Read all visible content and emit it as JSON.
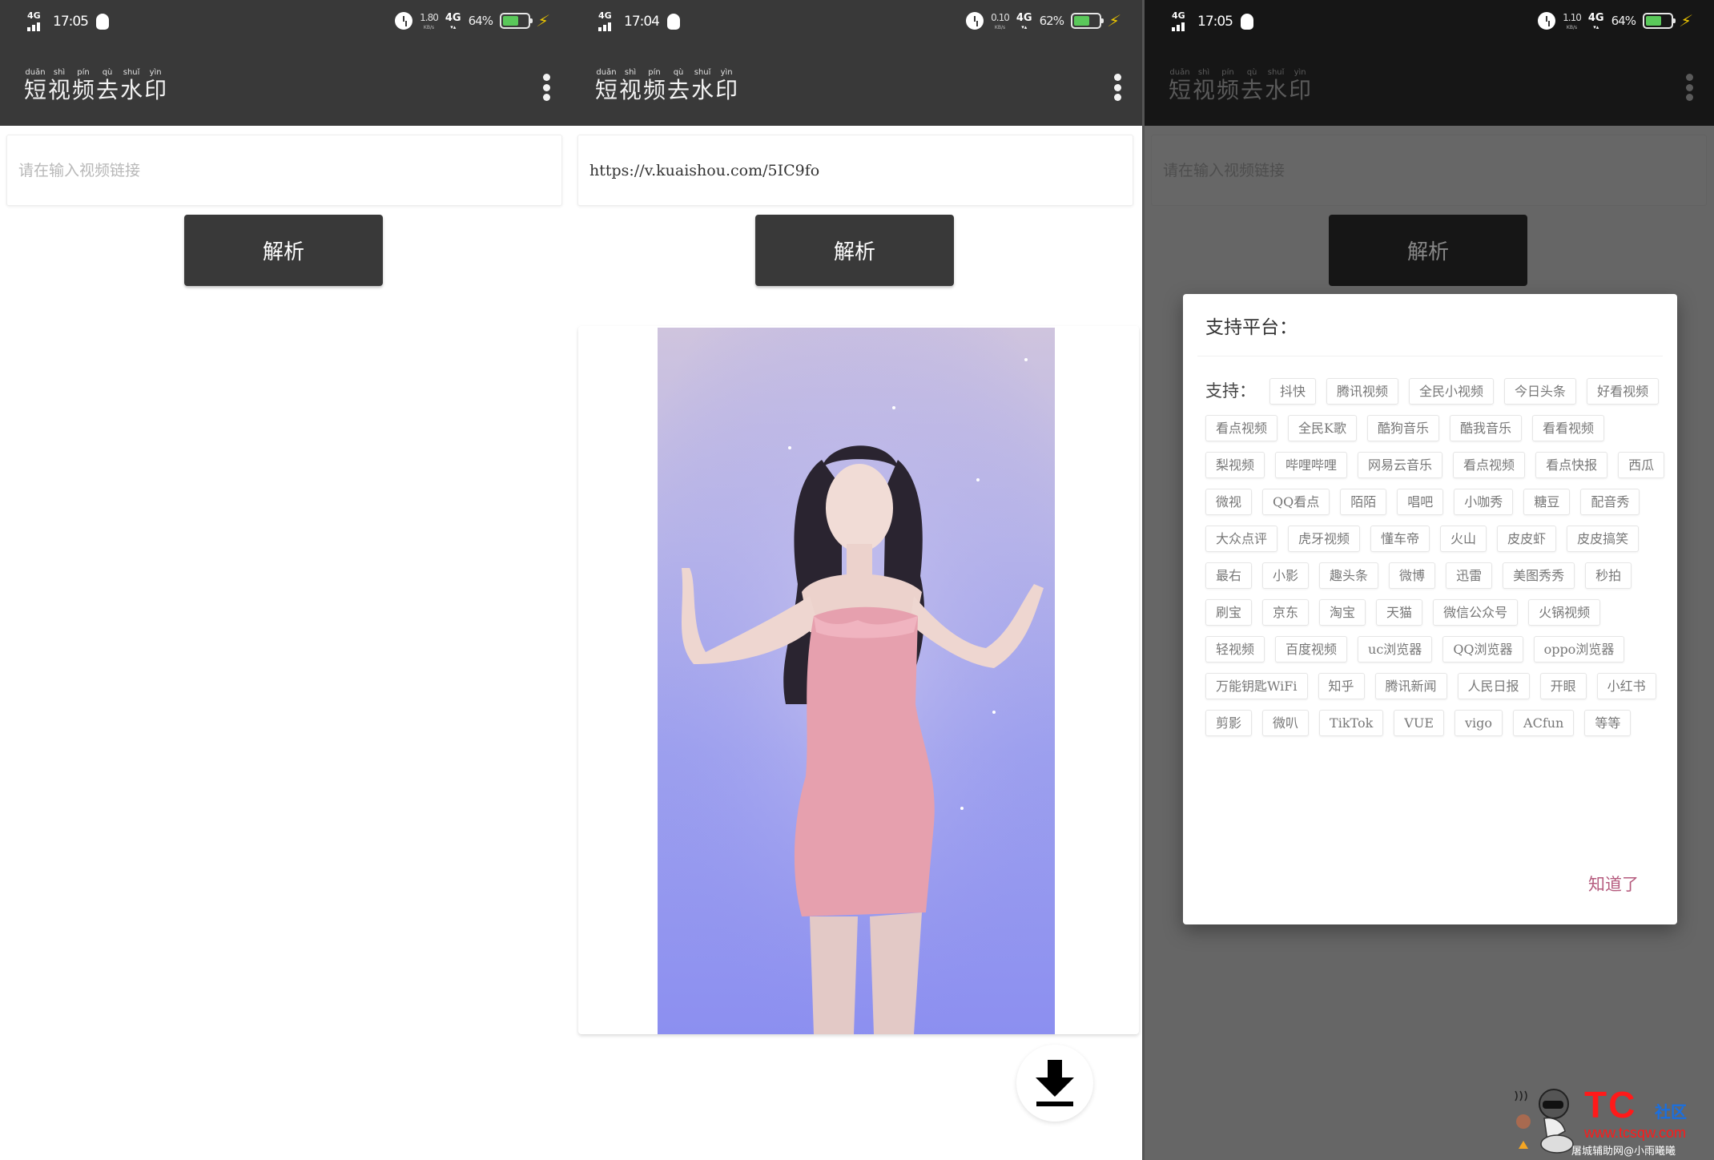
{
  "panels": [
    {
      "status_bar": {
        "network": "4G",
        "time": "17:05",
        "speed_value": "1.80",
        "speed_unit": "KB/s",
        "data_network": "4G",
        "battery_percent": "64%",
        "battery_level": 0.64
      },
      "app_bar": {
        "title_chars": [
          "短",
          "视",
          "频",
          "去",
          "水",
          "印"
        ],
        "title_pinyin": [
          "duǎn",
          "shì",
          "pín",
          "qù",
          "shuǐ",
          "yìn"
        ],
        "menu_icon": "more-vert-icon"
      },
      "input": {
        "value": "",
        "placeholder": "请在输入视频链接"
      },
      "parse_button": {
        "label": "解析"
      }
    },
    {
      "status_bar": {
        "network": "4G",
        "time": "17:04",
        "speed_value": "0.10",
        "speed_unit": "KB/s",
        "data_network": "4G",
        "battery_percent": "62%",
        "battery_level": 0.62
      },
      "app_bar": {
        "title_chars": [
          "短",
          "视",
          "频",
          "去",
          "水",
          "印"
        ],
        "title_pinyin": [
          "duǎn",
          "shì",
          "pín",
          "qù",
          "shuǐ",
          "yìn"
        ],
        "menu_icon": "more-vert-icon"
      },
      "input": {
        "value": "https://v.kuaishou.com/5IC9fo",
        "placeholder": "请在输入视频链接"
      },
      "parse_button": {
        "label": "解析"
      },
      "video_preview": {
        "description": "parsed video preview: woman in pink dress on purple background"
      },
      "download_button": {
        "icon": "download-icon"
      }
    },
    {
      "status_bar": {
        "network": "4G",
        "time": "17:05",
        "speed_value": "1.10",
        "speed_unit": "KB/s",
        "data_network": "4G",
        "battery_percent": "64%",
        "battery_level": 0.64
      },
      "app_bar": {
        "title_chars": [
          "短",
          "视",
          "频",
          "去",
          "水",
          "印"
        ],
        "title_pinyin": [
          "duǎn",
          "shì",
          "pín",
          "qù",
          "shuǐ",
          "yìn"
        ],
        "menu_icon": "more-vert-icon"
      },
      "input": {
        "value": "",
        "placeholder": "请在输入视频链接"
      },
      "parse_button": {
        "label": "解析"
      },
      "dialog": {
        "title": "支持平台：",
        "lead": "支持：",
        "platforms": [
          "抖快",
          "腾讯视频",
          "全民小视频",
          "今日头条",
          "好看视频",
          "看点视频",
          "全民K歌",
          "酷狗音乐",
          "酷我音乐",
          "看看视频",
          "梨视频",
          "哔哩哔哩",
          "网易云音乐",
          "看点视频",
          "看点快报",
          "西瓜",
          "微视",
          "QQ看点",
          "陌陌",
          "唱吧",
          "小咖秀",
          "糖豆",
          "配音秀",
          "大众点评",
          "虎牙视频",
          "懂车帝",
          "火山",
          "皮皮虾",
          "皮皮搞笑",
          "最右",
          "小影",
          "趣头条",
          "微博",
          "迅雷",
          "美图秀秀",
          "秒拍",
          "刷宝",
          "京东",
          "淘宝",
          "天猫",
          "微信公众号",
          "火锅视频",
          "轻视频",
          "百度视频",
          "uc浏览器",
          "QQ浏览器",
          "oppo浏览器",
          "万能钥匙WiFi",
          "知乎",
          "腾讯新闻",
          "人民日报",
          "开眼",
          "小红书",
          "剪影",
          "微叭",
          "TikTok",
          "VUE",
          "vigo",
          "ACfun",
          "等等"
        ],
        "ok_label": "知道了"
      }
    }
  ],
  "watermark": {
    "brand": "TC",
    "brand_suffix": "社区",
    "url": "www.tcsqw.com",
    "credit": "屠城辅助网@小雨曦曦"
  },
  "colors": {
    "appbar": "#393939",
    "button": "#393939",
    "battery_fill": "#5ac85a",
    "bolt": "#e8c200",
    "dialog_ok": "#b55b7e",
    "scrim": "#666666"
  }
}
